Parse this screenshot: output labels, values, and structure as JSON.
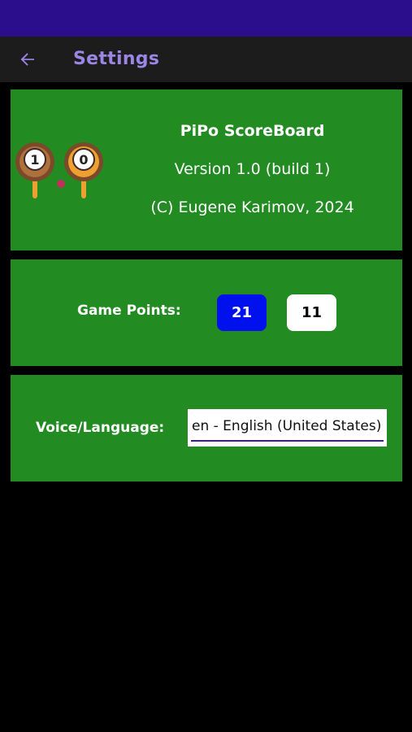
{
  "app_bar": {
    "title": "Settings"
  },
  "about": {
    "app_name": "PiPo ScoreBoard",
    "version": "Version 1.0   (build 1)",
    "copyright": "(C) Eugene Karimov, 2024",
    "logo_scores": [
      "1",
      "0"
    ]
  },
  "game_points": {
    "label": "Game Points:",
    "options": [
      "21",
      "11"
    ],
    "selected": "21"
  },
  "voice": {
    "label": "Voice/Language:",
    "value": "en - English (United States)"
  },
  "colors": {
    "status_bar": "#2a0e8c",
    "app_bar": "#1c1c1c",
    "accent": "#9b86e6",
    "card": "#228b22",
    "selected_option": "#0011ee",
    "underline": "#3b1aa5"
  }
}
